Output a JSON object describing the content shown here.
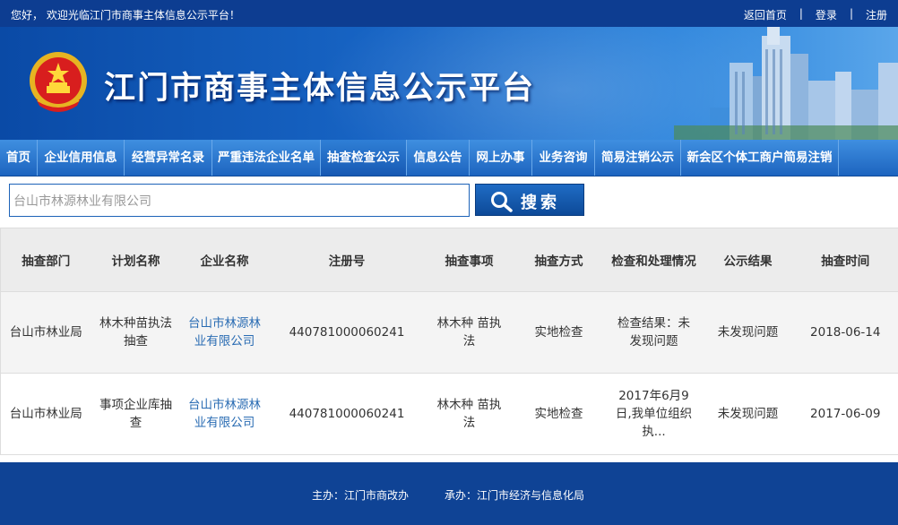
{
  "topbar": {
    "welcome": "您好， 欢迎光临江门市商事主体信息公示平台！",
    "links": [
      "返回首页",
      "登录",
      "注册"
    ],
    "separator": "|"
  },
  "banner": {
    "title": "江门市商事主体信息公示平台"
  },
  "nav": {
    "items": [
      "首页",
      "企业信用信息",
      "经营异常名录",
      "严重违法企业名单",
      "抽查检查公示",
      "信息公告",
      "网上办事",
      "业务咨询",
      "简易注销公示",
      "新会区个体工商户简易注销"
    ],
    "active_index": 4
  },
  "search": {
    "value": "台山市林源林业有限公司",
    "button_label": "搜索"
  },
  "table": {
    "headers": [
      "抽查部门",
      "计划名称",
      "企业名称",
      "注册号",
      "抽查事项",
      "抽查方式",
      "检查和处理情况",
      "公示结果",
      "抽查时间"
    ],
    "rows": [
      [
        "台山市林业局",
        "林木种苗执法抽查",
        "台山市林源林业有限公司",
        "440781000060241",
        "林木种 苗执法",
        "实地检查",
        "检查结果：未发现问题",
        "未发现问题",
        "2018-06-14"
      ],
      [
        "台山市林业局",
        "事项企业库抽查",
        "台山市林源林业有限公司",
        "440781000060241",
        "林木种 苗执法",
        "实地检查",
        "2017年6月9日,我单位组织执...",
        "未发现问题",
        "2017-06-09"
      ]
    ]
  },
  "footer": {
    "sponsor": "主办：江门市商改办",
    "organizer": "承办：江门市经济与信息化局"
  }
}
